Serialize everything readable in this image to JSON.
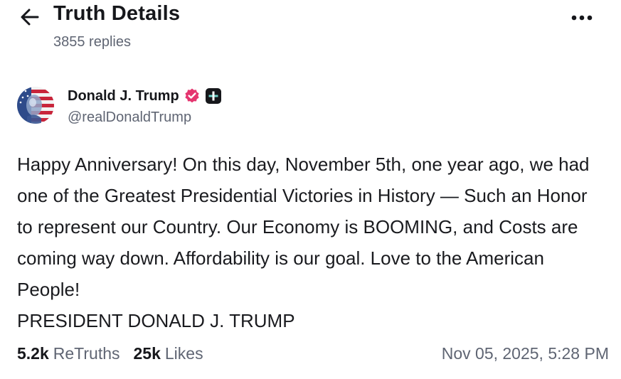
{
  "header": {
    "back_icon": "arrow-left-icon",
    "title": "Truth Details",
    "replies": "3855 replies",
    "more_icon": "more-horizontal-icon"
  },
  "author": {
    "name": "Donald J. Trump",
    "handle": "@realDonaldTrump",
    "avatar_icon": "flag-portrait-avatar",
    "verified_icon": "verified-badge-icon",
    "plus_icon": "truth-plus-badge-icon",
    "verified_color": "#e5356f"
  },
  "post": {
    "paragraphs": [
      "Happy Anniversary! On this day, November 5th, one year ago, we had one of the Greatest Presidential Victories in History — Such an Honor to represent our Country. Our Economy is BOOMING, and Costs are coming way down. Affordability is our goal. Love to the American People!",
      "PRESIDENT DONALD J. TRUMP"
    ]
  },
  "stats": {
    "retruths_count": "5.2k",
    "retruths_label": "ReTruths",
    "likes_count": "25k",
    "likes_label": "Likes",
    "timestamp": "Nov 05, 2025, 5:28 PM"
  }
}
